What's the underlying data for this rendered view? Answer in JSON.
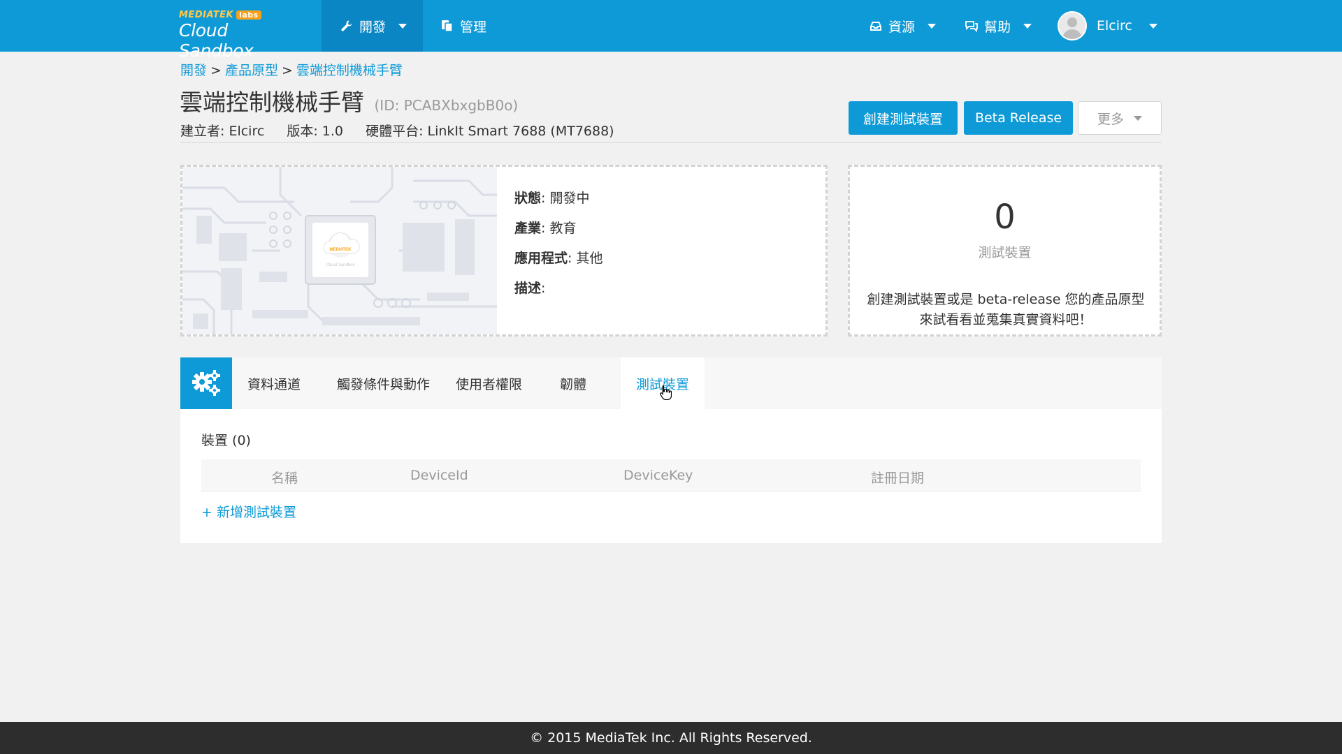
{
  "navbar": {
    "logo_top": "MEDIATEK",
    "logo_labs": "labs",
    "logo_brand": "Cloud Sandbox",
    "develop": "開發",
    "manage": "管理",
    "resources": "資源",
    "help": "幫助",
    "user": "Elcirc"
  },
  "breadcrumb": {
    "item1": "開發",
    "item2": "產品原型",
    "item3": "雲端控制機械手臂",
    "sep": ">"
  },
  "header": {
    "title": "雲端控制機械手臂",
    "id_text": "(ID: PCABXbxgbB0o)",
    "creator": "建立者: Elcirc",
    "version": "版本: 1.0",
    "platform": "硬體平台: LinkIt Smart 7688 (MT7688)",
    "btn_create": "創建測試裝置",
    "btn_beta": "Beta Release",
    "btn_more": "更多"
  },
  "info": {
    "status_label": "狀態",
    "status_value": ": 開發中",
    "industry_label": "產業",
    "industry_value": ": 教育",
    "app_label": "應用程式",
    "app_value": ": 其他",
    "desc_label": "描述",
    "desc_value": ":",
    "img_logo": "MEDIATEK",
    "img_caption": "Cloud Sandbox"
  },
  "devices_card": {
    "count": "0",
    "label": "測試裝置",
    "desc": "創建測試裝置或是 beta-release 您的產品原型來試看看並蒐集真實資料吧！"
  },
  "tabs": {
    "t1": "資料通道",
    "t2": "觸發條件與動作",
    "t3": "使用者權限",
    "t4": "韌體",
    "t5": "測試裝置"
  },
  "device_table": {
    "title": "裝置 (0)",
    "col_name": "名稱",
    "col_id": "DeviceId",
    "col_key": "DeviceKey",
    "col_date": "註冊日期",
    "add": "+ 新增測試裝置"
  },
  "footer": {
    "text": "© 2015 MediaTek Inc. All Rights Reserved."
  },
  "colors": {
    "primary": "#0e9ad7",
    "footer_bg": "#2d2d2d"
  }
}
